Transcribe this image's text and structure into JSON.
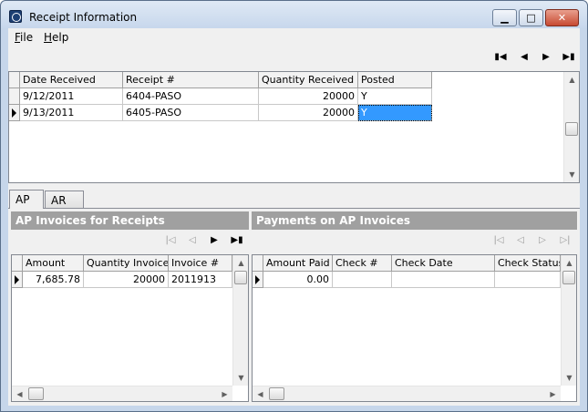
{
  "window": {
    "title": "Receipt Information"
  },
  "menu": {
    "file": "F",
    "file_rest": "ile",
    "help": "H",
    "help_rest": "elp"
  },
  "receipts": {
    "columns": [
      "Date Received",
      "Receipt #",
      "Quantity Received",
      "Posted"
    ],
    "rows": [
      [
        "9/12/2011",
        "6404-PASO",
        "20000",
        "Y"
      ],
      [
        "9/13/2011",
        "6405-PASO",
        "20000",
        "Y"
      ]
    ]
  },
  "tabs": [
    "AP",
    "AR"
  ],
  "ap_invoices": {
    "title": "AP Invoices for Receipts",
    "columns": [
      "Amount",
      "Quantity Invoiced",
      "Invoice #"
    ],
    "rows": [
      [
        "7,685.78",
        "20000",
        "2011913"
      ]
    ]
  },
  "payments": {
    "title": "Payments on AP Invoices",
    "columns": [
      "Amount Paid",
      "Check #",
      "Check Date",
      "Check Status"
    ],
    "rows": [
      [
        "0.00",
        "",
        "",
        ""
      ]
    ]
  },
  "icons": {
    "first": "first-record-icon",
    "prev": "previous-record-icon",
    "next": "next-record-icon",
    "last": "last-record-icon"
  },
  "colors": {
    "selection": "#3399ff",
    "panel_header": "#a0a0a0"
  }
}
